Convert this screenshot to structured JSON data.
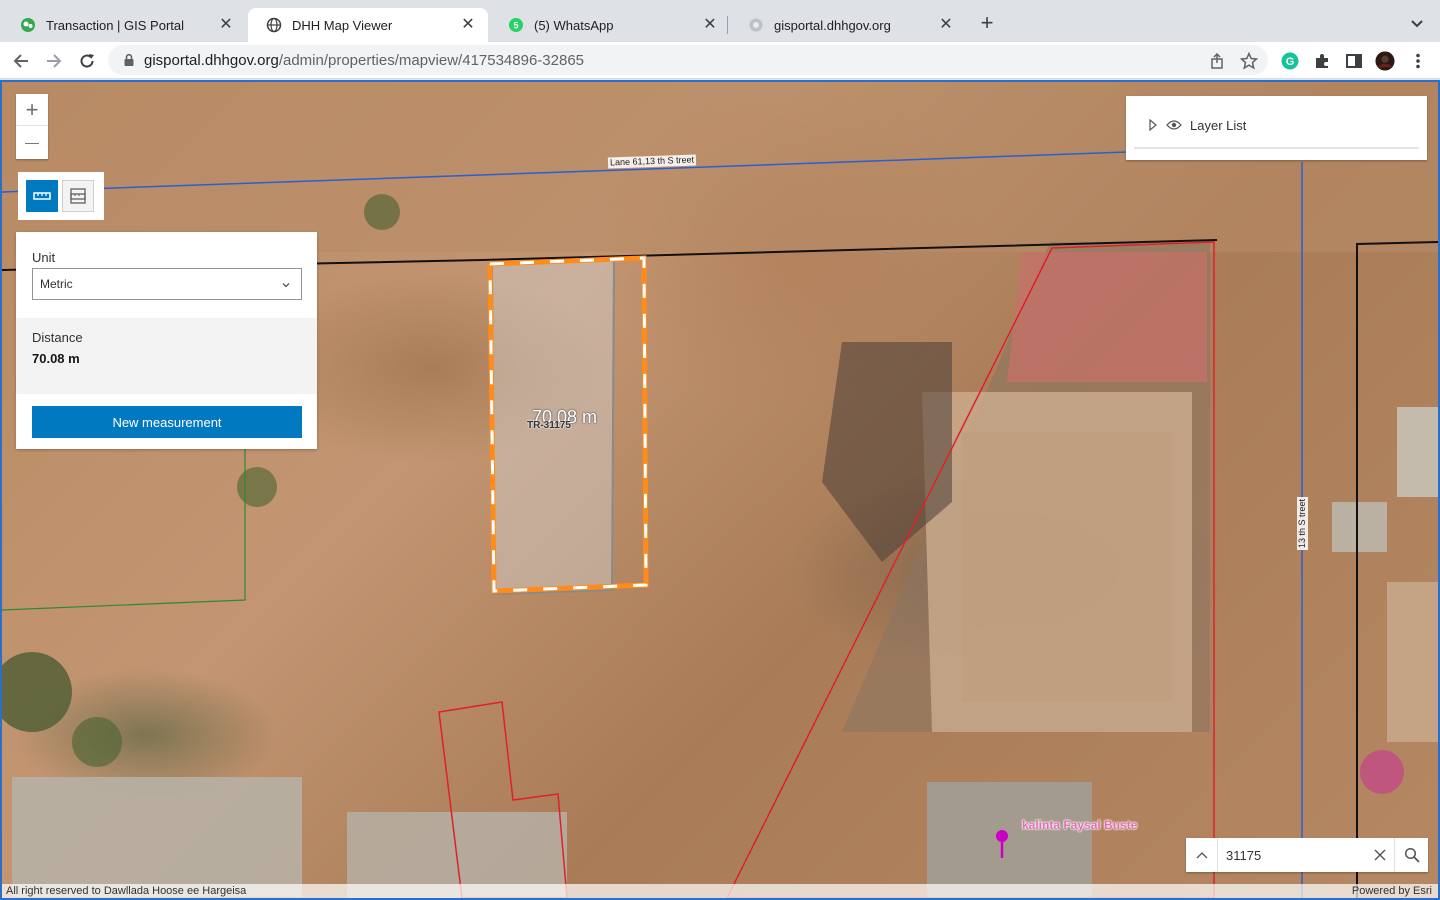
{
  "browser": {
    "tabs": [
      {
        "title": "Transaction | GIS Portal",
        "icon": "gis-portal-favicon"
      },
      {
        "title": "DHH Map Viewer",
        "icon": "globe-icon",
        "active": true
      },
      {
        "title": "(5) WhatsApp",
        "icon": "whatsapp-icon",
        "badge": "5"
      },
      {
        "title": "gisportal.dhhgov.org",
        "icon": "globe-icon"
      }
    ],
    "close_glyph": "✕",
    "new_tab_glyph": "+",
    "url_host": "gisportal.dhhgov.org",
    "url_path": "/admin/properties/mapview/417534896-32865",
    "profile_initial": ""
  },
  "map": {
    "zoom_in": "+",
    "zoom_out": "—",
    "measurement": {
      "unit_label": "Unit",
      "unit_value": "Metric",
      "distance_label": "Distance",
      "distance_value": "70.08 m",
      "new_button": "New measurement"
    },
    "layer_list_label": "Layer List",
    "labels": {
      "street_top": "Lane 61,13 th S treet",
      "street_right": "13 th S treet",
      "measure_overlay": "70.08 m",
      "parcel_id": "TR-31175",
      "poi": "kalinta Faysal Buste"
    },
    "search": {
      "value": "31175"
    },
    "attribution_left": "All right reserved to Dawllada Hoose ee Hargeisa",
    "attribution_right": "Powered by Esri"
  },
  "colors": {
    "accent": "#0079c1",
    "measure_orange": "#ff8c1a",
    "parcel_red": "#e0202a",
    "road_blue": "#2a5fd0",
    "poi_pink": "#e36fb0",
    "poi_marker": "#c800c8"
  }
}
